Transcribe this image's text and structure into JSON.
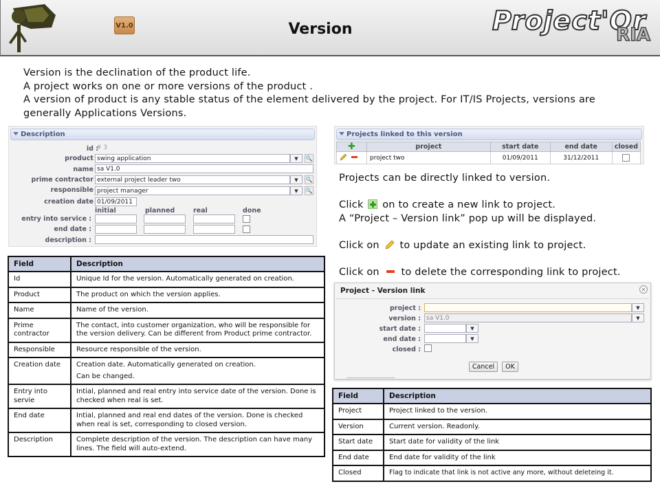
{
  "header": {
    "title": "Version",
    "version_badge": "V1.0",
    "brand_main": "Project'Or",
    "brand_sub": "RIA",
    "logo_icon": "camera-on-tripod-icon"
  },
  "intro": {
    "line1": "Version is the declination of the product life.",
    "line2": "A project works on one or more versions of the product .",
    "line3": "A version of product is any stable status of the element delivered by the project. For IT/IS Projects, versions are generally Applications Versions."
  },
  "description_panel": {
    "section_title": "Description",
    "fields": {
      "id_label": "id :",
      "id_value": "# 3",
      "product_label": "product :",
      "product_value": "swing application",
      "name_label": "name :",
      "name_value": "sa V1.0",
      "prime_label": "prime contractor :",
      "prime_value": "external project leader two",
      "responsible_label": "responsible :",
      "responsible_value": "project manager",
      "creation_label": "creation date :",
      "creation_value": "01/09/2011",
      "col_initial": "initial",
      "col_planned": "planned",
      "col_real": "real",
      "col_done": "done",
      "entry_label": "entry into service :",
      "end_label": "end date :",
      "description_label": "description :"
    }
  },
  "field_table": {
    "headers": [
      "Field",
      "Description"
    ],
    "rows": [
      [
        "Id",
        "Unique Id for the version. Automatically generated on creation."
      ],
      [
        "Product",
        "The product on which the version applies."
      ],
      [
        "Name",
        "Name of the version."
      ],
      [
        "Prime contractor",
        "The contact, into customer organization, who will be responsible for the version delivery. Can be different from Product prime contractor."
      ],
      [
        "Responsible",
        "Resource responsible of the version."
      ],
      [
        "Creation date",
        "Creation date. Automatically generated on creation."
      ],
      [
        "Entry into servie",
        "Intial, planned and real entry into service date of the version. Done is checked when real is set."
      ],
      [
        "End date",
        "Intial, planned and real end dates of the version. Done is checked when real is set, corresponding to closed version."
      ],
      [
        "Description",
        "Complete description of the version. The description can have many lines. The field will auto-extend."
      ]
    ],
    "creation_extra": "Can be changed."
  },
  "projects_panel": {
    "section_title": "Projects linked to this version",
    "headers": [
      "project",
      "start date",
      "end date",
      "closed"
    ],
    "row": [
      "project two",
      "01/09/2011",
      "31/12/2011"
    ]
  },
  "projects_text": {
    "line1": "Projects can be directly linked to version.",
    "click_word": "Click",
    "add_rest": "on to create a new link to project.",
    "popup_line": "A “Project – Version link” pop up will be displayed.",
    "click_on": "Click on",
    "edit_rest": "to update an existing link to project.",
    "delete_rest": "to delete the corresponding link to project."
  },
  "popup": {
    "title": "Project - Version link",
    "project_label": "project :",
    "version_label": "version :",
    "version_value": "sa V1.0",
    "start_label": "start date :",
    "end_label": "end date :",
    "closed_label": "closed :",
    "cancel": "Cancel",
    "ok": "OK"
  },
  "link_table": {
    "headers": [
      "Field",
      "Description"
    ],
    "rows": [
      [
        "Project",
        "Project linked to the version."
      ],
      [
        "Version",
        "Current version. Readonly."
      ],
      [
        "Start date",
        "Start date for validity of the link"
      ],
      [
        "End date",
        "End date for validity of the link"
      ],
      [
        "Closed",
        "Flag to indicate that link is not active any more, without deleteing it."
      ]
    ]
  }
}
